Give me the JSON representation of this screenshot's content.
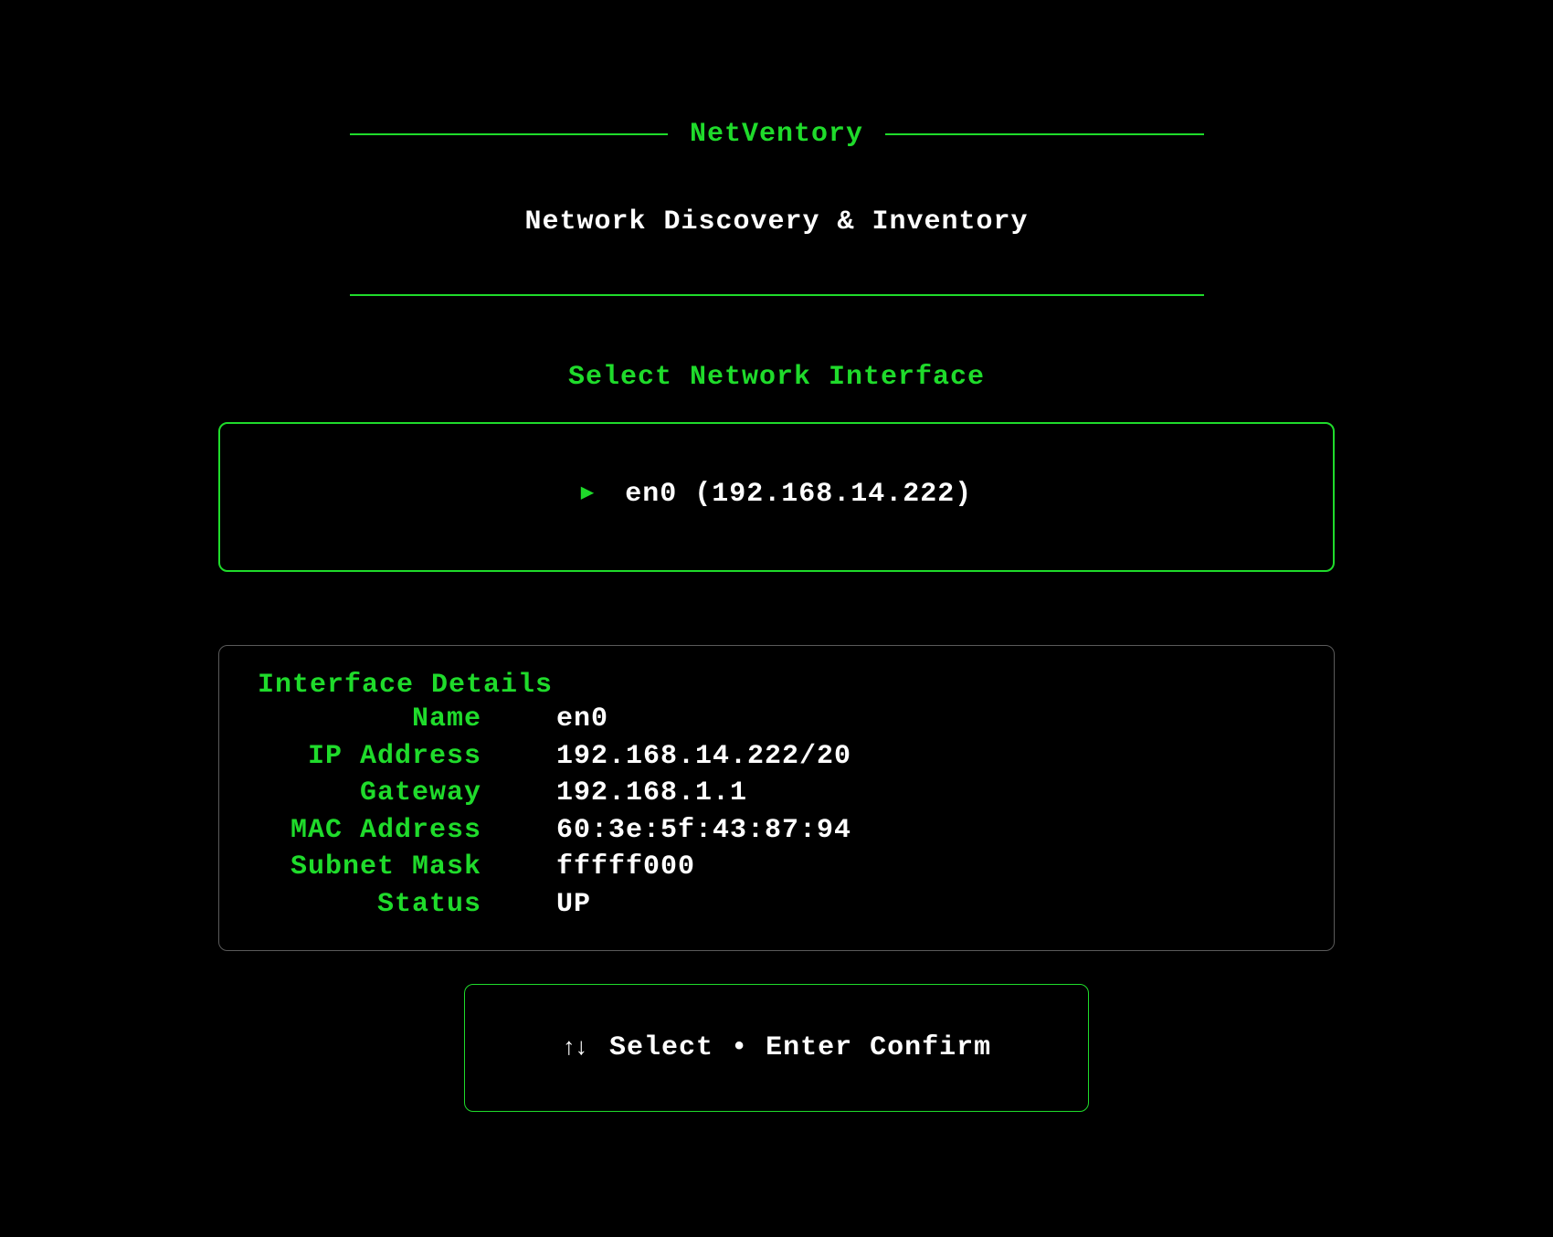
{
  "header": {
    "title": "NetVentory",
    "subtitle": "Network Discovery & Inventory"
  },
  "section": {
    "heading": "Select Network Interface"
  },
  "interfaces": {
    "items": [
      {
        "label": "en0 (192.168.14.222)"
      }
    ]
  },
  "details": {
    "title": "Interface Details",
    "rows": [
      {
        "key": "Name",
        "value": "en0"
      },
      {
        "key": "IP Address",
        "value": "192.168.14.222/20"
      },
      {
        "key": "Gateway",
        "value": "192.168.1.1"
      },
      {
        "key": "MAC Address",
        "value": "60:3e:5f:43:87:94"
      },
      {
        "key": "Subnet Mask",
        "value": "fffff000"
      },
      {
        "key": "Status",
        "value": "UP"
      }
    ]
  },
  "hint": {
    "arrows": "↑↓",
    "select_label": "Select",
    "separator": "•",
    "enter_key": "Enter",
    "confirm_label": "Confirm"
  }
}
